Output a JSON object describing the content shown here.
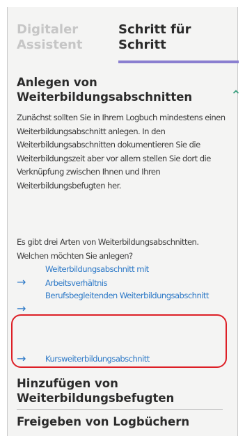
{
  "tabs": {
    "inactive_label": "Digitaler Assistent",
    "active_label": "Schritt für Schritt"
  },
  "accordion": {
    "open_section_title": "Anlegen von Weiterbildungsabschnitten",
    "paragraph_1": "Zunächst sollten Sie in Ihrem Logbuch mindestens einen Weiterbildungsabschnitt anlegen. In den Weiterbildungsabschnitten dokumentieren Sie die Weiterbildungszeit aber vor allem stellen Sie dort die Verknüpfung zwischen Ihnen und Ihren Weiterbildungsbefugten her.",
    "paragraph_2": "Es gibt drei Arten von Weiterbildungsabschnitten. Welchen möchten Sie anlegen?",
    "links": [
      {
        "label": "Weiterbildungsabschnitt mit Arbeitsverhältnis"
      },
      {
        "label": "Berufsbegleitenden Weiterbildungsabschnitt"
      },
      {
        "label": "Kursweiterbildungsabschnitt"
      }
    ],
    "section_2_title": "Hinzufügen von Weiterbildungsbefugten",
    "section_3_title": "Freigeben von Logbüchern"
  },
  "colors": {
    "accent_underline": "#8a7fd0",
    "link": "#2d79c7",
    "chevron": "#2e9b78",
    "highlight_border": "#dd1f26"
  },
  "icons": {
    "chevron": "chevron-up-icon",
    "link_arrow": "arrow-right-icon"
  }
}
